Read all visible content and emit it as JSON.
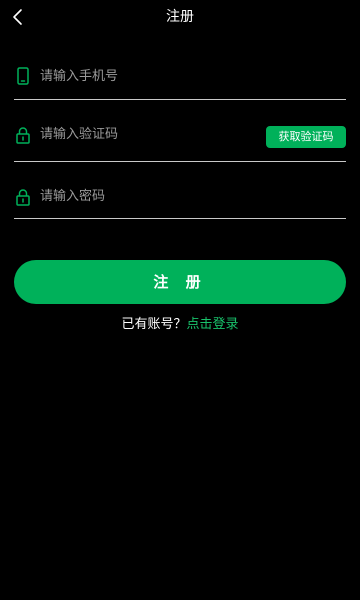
{
  "header": {
    "title": "注册",
    "back_icon": "chevron-left-icon"
  },
  "form": {
    "phone": {
      "icon": "phone-icon",
      "placeholder": "请输入手机号",
      "value": ""
    },
    "code": {
      "icon": "lock-icon",
      "placeholder": "请输入验证码",
      "value": "",
      "button_label": "获取验证码"
    },
    "password": {
      "icon": "lock-icon",
      "placeholder": "请输入密码",
      "value": ""
    }
  },
  "register_button": {
    "label": "注 册"
  },
  "login_prompt": {
    "text": "已有账号？",
    "link": "点击登录"
  },
  "colors": {
    "background": "#000000",
    "accent": "#00b15a",
    "link": "#19c26b",
    "divider": "#c9c9c9"
  }
}
